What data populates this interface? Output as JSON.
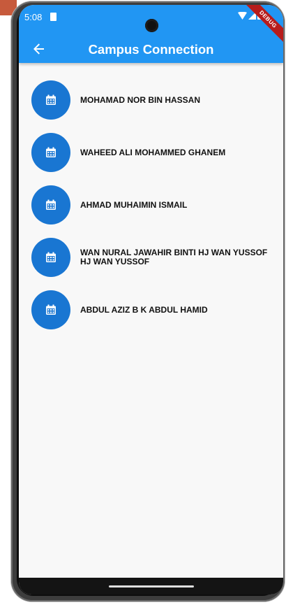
{
  "status_bar": {
    "time": "5:08",
    "debug_label": "DEBUG"
  },
  "app_bar": {
    "title": "Campus Connection",
    "back_icon": "arrow-back-icon"
  },
  "colors": {
    "app_bar": "#2196f3",
    "avatar": "#1976d2",
    "background": "#f8f8f8"
  },
  "list": {
    "item_icon": "calendar-icon",
    "items": [
      {
        "label": "MOHAMAD NOR BIN HASSAN"
      },
      {
        "label": "WAHEED ALI MOHAMMED GHANEM"
      },
      {
        "label": "AHMAD MUHAIMIN ISMAIL"
      },
      {
        "label": "WAN NURAL JAWAHIR BINTI HJ WAN YUSSOF HJ WAN YUSSOF"
      },
      {
        "label": "ABDUL AZIZ B K ABDUL HAMID"
      }
    ]
  }
}
